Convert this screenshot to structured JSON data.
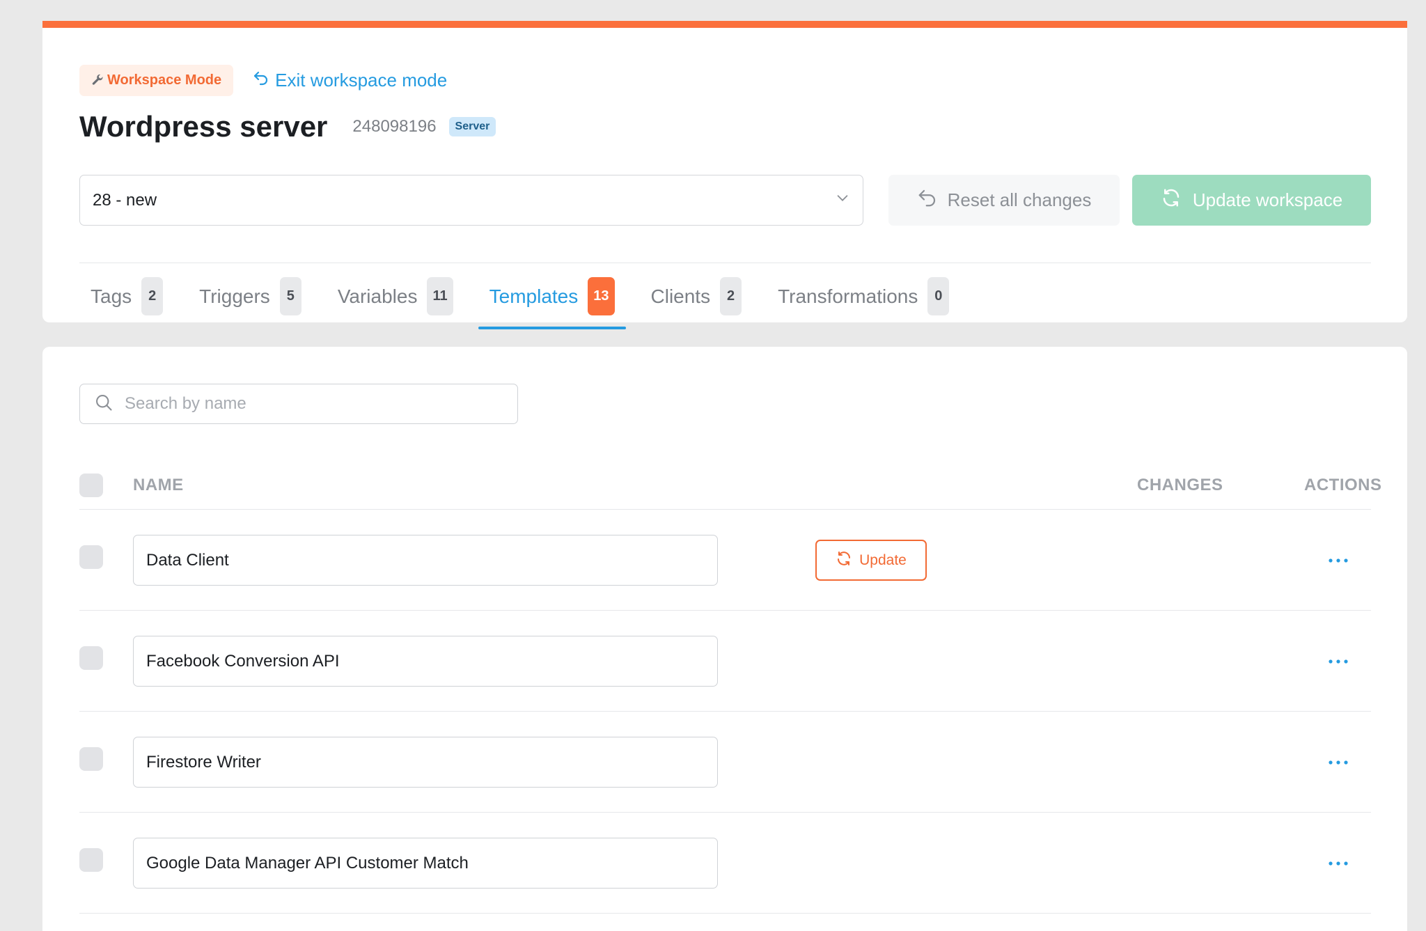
{
  "workspace": {
    "mode_label": "Workspace Mode",
    "exit_label": "Exit workspace mode"
  },
  "container": {
    "title": "Wordpress server",
    "id": "248098196",
    "type_badge": "Server"
  },
  "controls": {
    "version_selected": "28 - new",
    "reset_label": "Reset all changes",
    "update_label": "Update workspace"
  },
  "tabs": [
    {
      "label": "Tags",
      "count": "2"
    },
    {
      "label": "Triggers",
      "count": "5"
    },
    {
      "label": "Variables",
      "count": "11"
    },
    {
      "label": "Templates",
      "count": "13"
    },
    {
      "label": "Clients",
      "count": "2"
    },
    {
      "label": "Transformations",
      "count": "0"
    }
  ],
  "active_tab": "Templates",
  "search": {
    "placeholder": "Search by name"
  },
  "table": {
    "headers": {
      "name": "NAME",
      "changes": "CHANGES",
      "actions": "ACTIONS"
    },
    "rows": [
      {
        "name": "Data Client",
        "update_label": "Update"
      },
      {
        "name": "Facebook Conversion API"
      },
      {
        "name": "Firestore Writer"
      },
      {
        "name": "Google Data Manager API Customer Match"
      }
    ]
  },
  "colors": {
    "accent_orange": "#fb6f3b",
    "link_blue": "#259be0",
    "update_green": "#9ddcbf"
  },
  "icons": {
    "mode": "wrench-icon",
    "exit": "undo-arrow-icon",
    "select": "chevron-down-icon",
    "reset": "undo-arrow-icon",
    "update": "refresh-icon",
    "search": "search-icon",
    "actions": "more-dots-icon"
  }
}
